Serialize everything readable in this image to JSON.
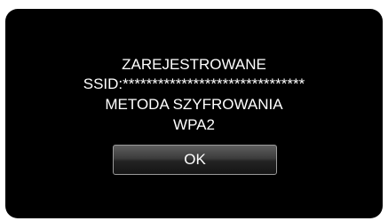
{
  "dialog": {
    "line1": "ZAREJESTROWANE",
    "line2": "SSID:*******************************",
    "line3": "METODA SZYFROWANIA",
    "line4": "WPA2"
  },
  "buttons": {
    "ok_label": "OK"
  },
  "colors": {
    "screen_background": "#000000",
    "text": "#ffffff",
    "button_border": "#9a9a9a"
  }
}
